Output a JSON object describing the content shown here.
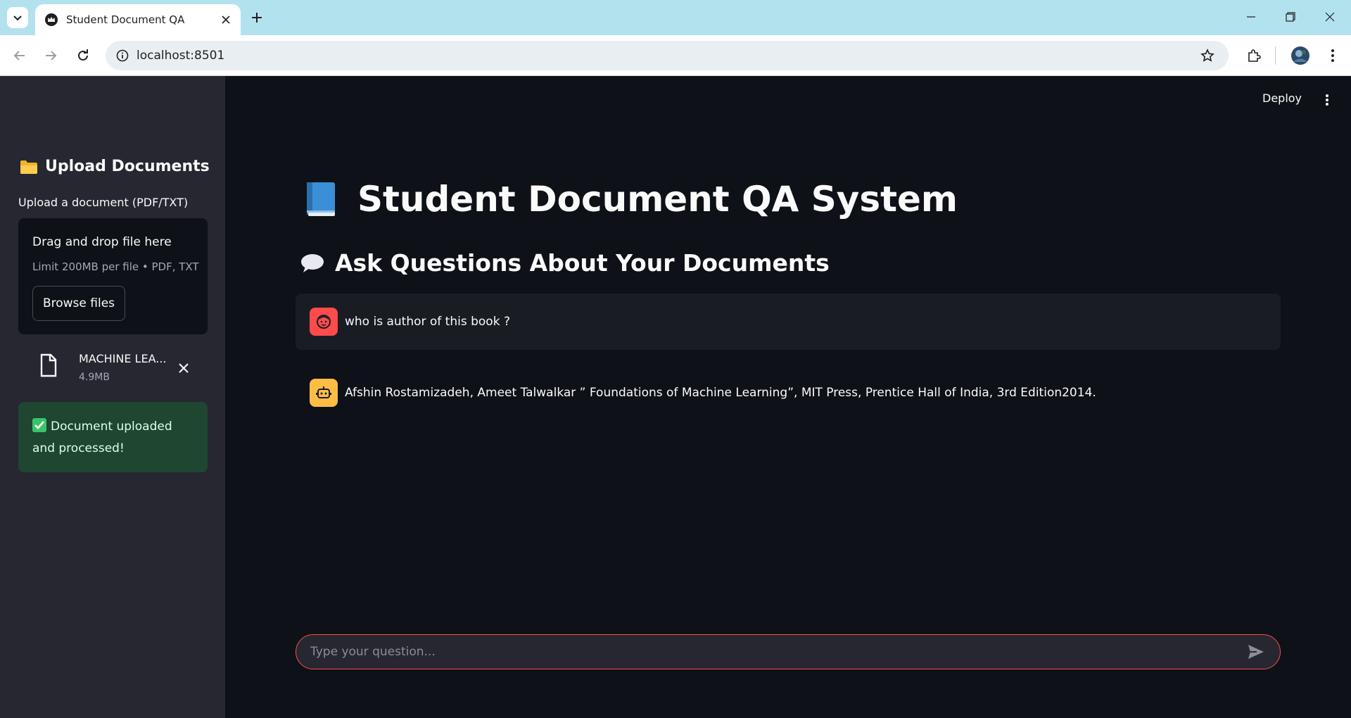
{
  "browser": {
    "tab_title": "Student Document QA",
    "url": "localhost:8501"
  },
  "sidebar": {
    "title": "Upload Documents",
    "upload_label": "Upload a document (PDF/TXT)",
    "dropzone_title": "Drag and drop file here",
    "dropzone_limit": "Limit 200MB per file • PDF, TXT",
    "browse_label": "Browse files",
    "file": {
      "name": "MACHINE LEA...",
      "size": "4.9MB"
    },
    "success_message": "Document uploaded and processed!"
  },
  "header": {
    "deploy_label": "Deploy"
  },
  "main": {
    "title": "Student Document QA System",
    "subheader": "Ask Questions About Your Documents",
    "messages": [
      {
        "role": "user",
        "text": "who is author of this book ?"
      },
      {
        "role": "assistant",
        "text": "Afshin Rostamizadeh, Ameet Talwalkar ” Foundations of Machine Learning”, MIT Press, Prentice Hall of India, 3rd Edition2014."
      }
    ],
    "chat_placeholder": "Type your question..."
  },
  "colors": {
    "accent": "#ff4b4b",
    "bot_avatar": "#ffbd45",
    "success_bg": "#1e4630",
    "sidebar_bg": "#262730",
    "main_bg": "#0e1117"
  },
  "icons": [
    "tab-list-icon",
    "streamlit-crown-icon",
    "close-icon",
    "plus-icon",
    "minimize-icon",
    "restore-icon",
    "back-icon",
    "forward-icon",
    "reload-icon",
    "site-info-icon",
    "star-icon",
    "extensions-icon",
    "profile-avatar",
    "menu-icon",
    "folder-icon",
    "file-icon",
    "book-icon",
    "speech-bubble-icon",
    "user-face-icon",
    "robot-icon",
    "send-icon",
    "check-icon"
  ]
}
